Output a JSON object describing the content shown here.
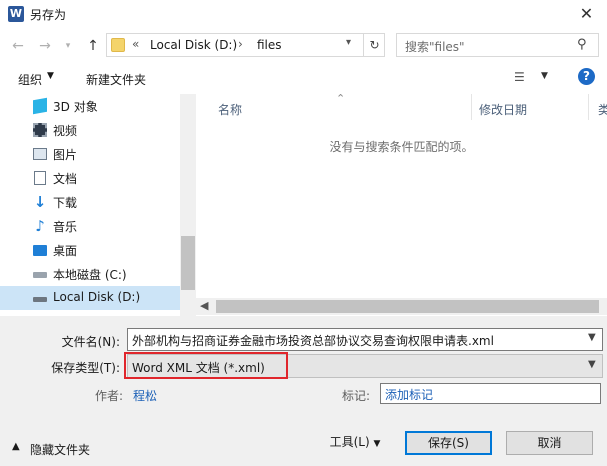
{
  "window": {
    "title": "另存为",
    "app_icon": "W"
  },
  "address_bar": {
    "root_chevron": "«",
    "crumbs": [
      "Local Disk (D:)",
      "files"
    ],
    "separator": "›"
  },
  "search": {
    "placeholder": "搜索\"files\""
  },
  "toolbar": {
    "organize": "组织",
    "new_folder": "新建文件夹"
  },
  "nav": {
    "items": [
      {
        "label": "3D 对象",
        "icon": "3d-objects-icon"
      },
      {
        "label": "视频",
        "icon": "video-icon"
      },
      {
        "label": "图片",
        "icon": "pictures-icon"
      },
      {
        "label": "文档",
        "icon": "documents-icon"
      },
      {
        "label": "下载",
        "icon": "download-icon"
      },
      {
        "label": "音乐",
        "icon": "music-icon"
      },
      {
        "label": "桌面",
        "icon": "desktop-icon"
      },
      {
        "label": "本地磁盘 (C:)",
        "icon": "drive-icon"
      },
      {
        "label": "Local Disk (D:)",
        "icon": "drive-icon",
        "selected": true
      }
    ]
  },
  "content": {
    "columns": [
      "名称",
      "修改日期",
      "类"
    ],
    "empty_message": "没有与搜索条件匹配的项。"
  },
  "form": {
    "filename_label": "文件名(N):",
    "filename_value": "外部机构与招商证券金融市场投资总部协议交易查询权限申请表.xml",
    "type_label": "保存类型(T):",
    "type_value": "Word XML 文档 (*.xml)",
    "author_label": "作者:",
    "author_value": "程松",
    "tags_label": "标记:",
    "tags_value": "添加标记"
  },
  "footer": {
    "hide_folders": "隐藏文件夹",
    "tools": "工具(L)",
    "save": "保存(S)",
    "cancel": "取消"
  },
  "colors": {
    "highlight_border": "#e0262c",
    "selection": "#cce4f7",
    "accent": "#0078d7"
  }
}
